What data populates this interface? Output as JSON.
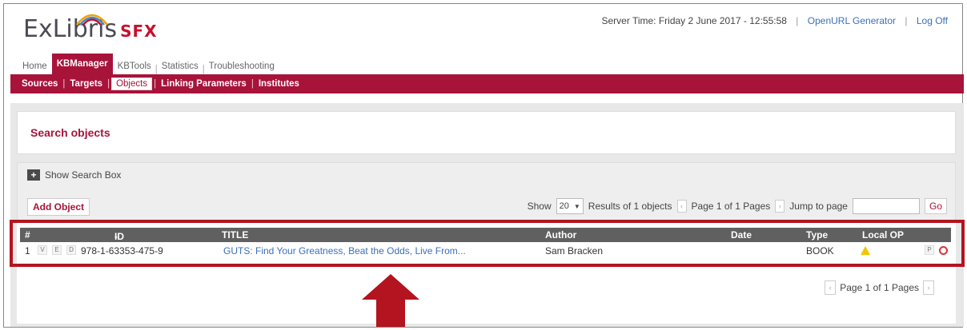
{
  "header": {
    "logo_main": "ExLibris",
    "logo_sub": "SFX",
    "server_time": "Server Time: Friday 2 June 2017 - 12:55:58",
    "openurl_link": "OpenURL Generator",
    "logoff_link": "Log Off"
  },
  "main_nav": [
    {
      "label": "Home",
      "active": false
    },
    {
      "label": "KBManager",
      "active": true
    },
    {
      "label": "KBTools",
      "active": false
    },
    {
      "label": "Statistics",
      "active": false
    },
    {
      "label": "Troubleshooting",
      "active": false
    }
  ],
  "sub_nav": [
    {
      "label": "Sources",
      "active": false
    },
    {
      "label": "Targets",
      "active": false
    },
    {
      "label": "Objects",
      "active": true
    },
    {
      "label": "Linking Parameters",
      "active": false
    },
    {
      "label": "Institutes",
      "active": false
    }
  ],
  "page_title": "Search objects",
  "toolbar": {
    "show_search_label": "Show Search Box",
    "add_object_label": "Add Object",
    "show_label": "Show",
    "page_size": "20",
    "results_text": "Results of 1 objects",
    "page_text": "Page 1 of 1 Pages",
    "jump_label": "Jump to page",
    "go_label": "Go"
  },
  "table": {
    "columns": [
      "#",
      "ID",
      "TITLE",
      "Author",
      "Date",
      "Type",
      "Local OP"
    ],
    "id_sort_arrow": "-",
    "rows": [
      {
        "num": "1",
        "btn_v": "V",
        "btn_e": "E",
        "btn_d": "D",
        "id": "978-1-63353-475-9",
        "title": "GUTS: Find Your Greatness, Beat the Odds, Live From...",
        "author": "Sam Bracken",
        "date": "",
        "type": "BOOK",
        "btn_p": "P"
      }
    ]
  },
  "bottom_pager": {
    "page_text": "Page 1 of 1 Pages"
  },
  "colors": {
    "brand": "#a8133a",
    "header_row": "#606060",
    "highlight": "#b3141f",
    "link": "#3a70b8"
  }
}
